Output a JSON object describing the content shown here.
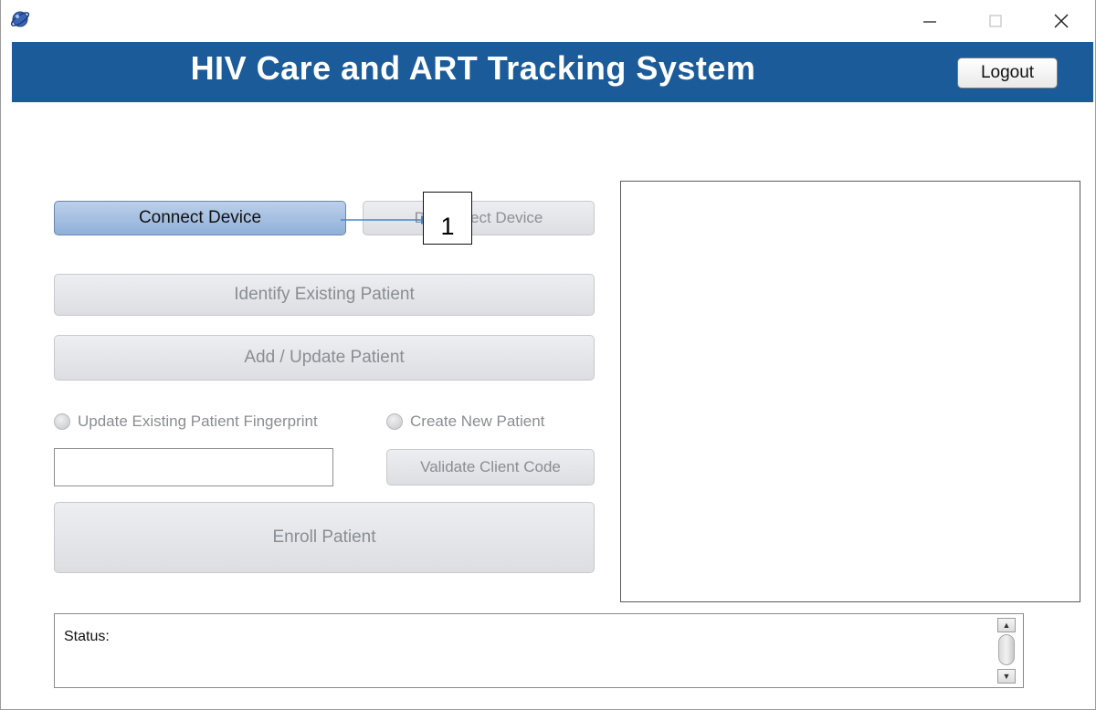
{
  "window": {
    "icon": "app-globe-icon",
    "controls": {
      "minimize_icon": "minimize-icon",
      "maximize_icon": "maximize-icon",
      "close_icon": "close-icon"
    }
  },
  "header": {
    "title": "HIV Care and ART Tracking System",
    "logout_label": "Logout",
    "background_color": "#1c5b99"
  },
  "device": {
    "connect_label": "Connect Device",
    "disconnect_label": "Disconnect Device"
  },
  "patient_actions": {
    "identify_label": "Identify Existing Patient",
    "add_update_label": "Add / Update Patient",
    "radio_update_fingerprint": "Update Existing Patient Fingerprint",
    "radio_create_new": "Create New Patient",
    "client_code_value": "",
    "validate_label": "Validate Client Code",
    "enroll_label": "Enroll Patient"
  },
  "annotation": {
    "number": "1"
  },
  "status": {
    "label": "Status:"
  },
  "colors": {
    "primary_button": "#9fbbe0",
    "disabled_text": "#8a8d91"
  }
}
